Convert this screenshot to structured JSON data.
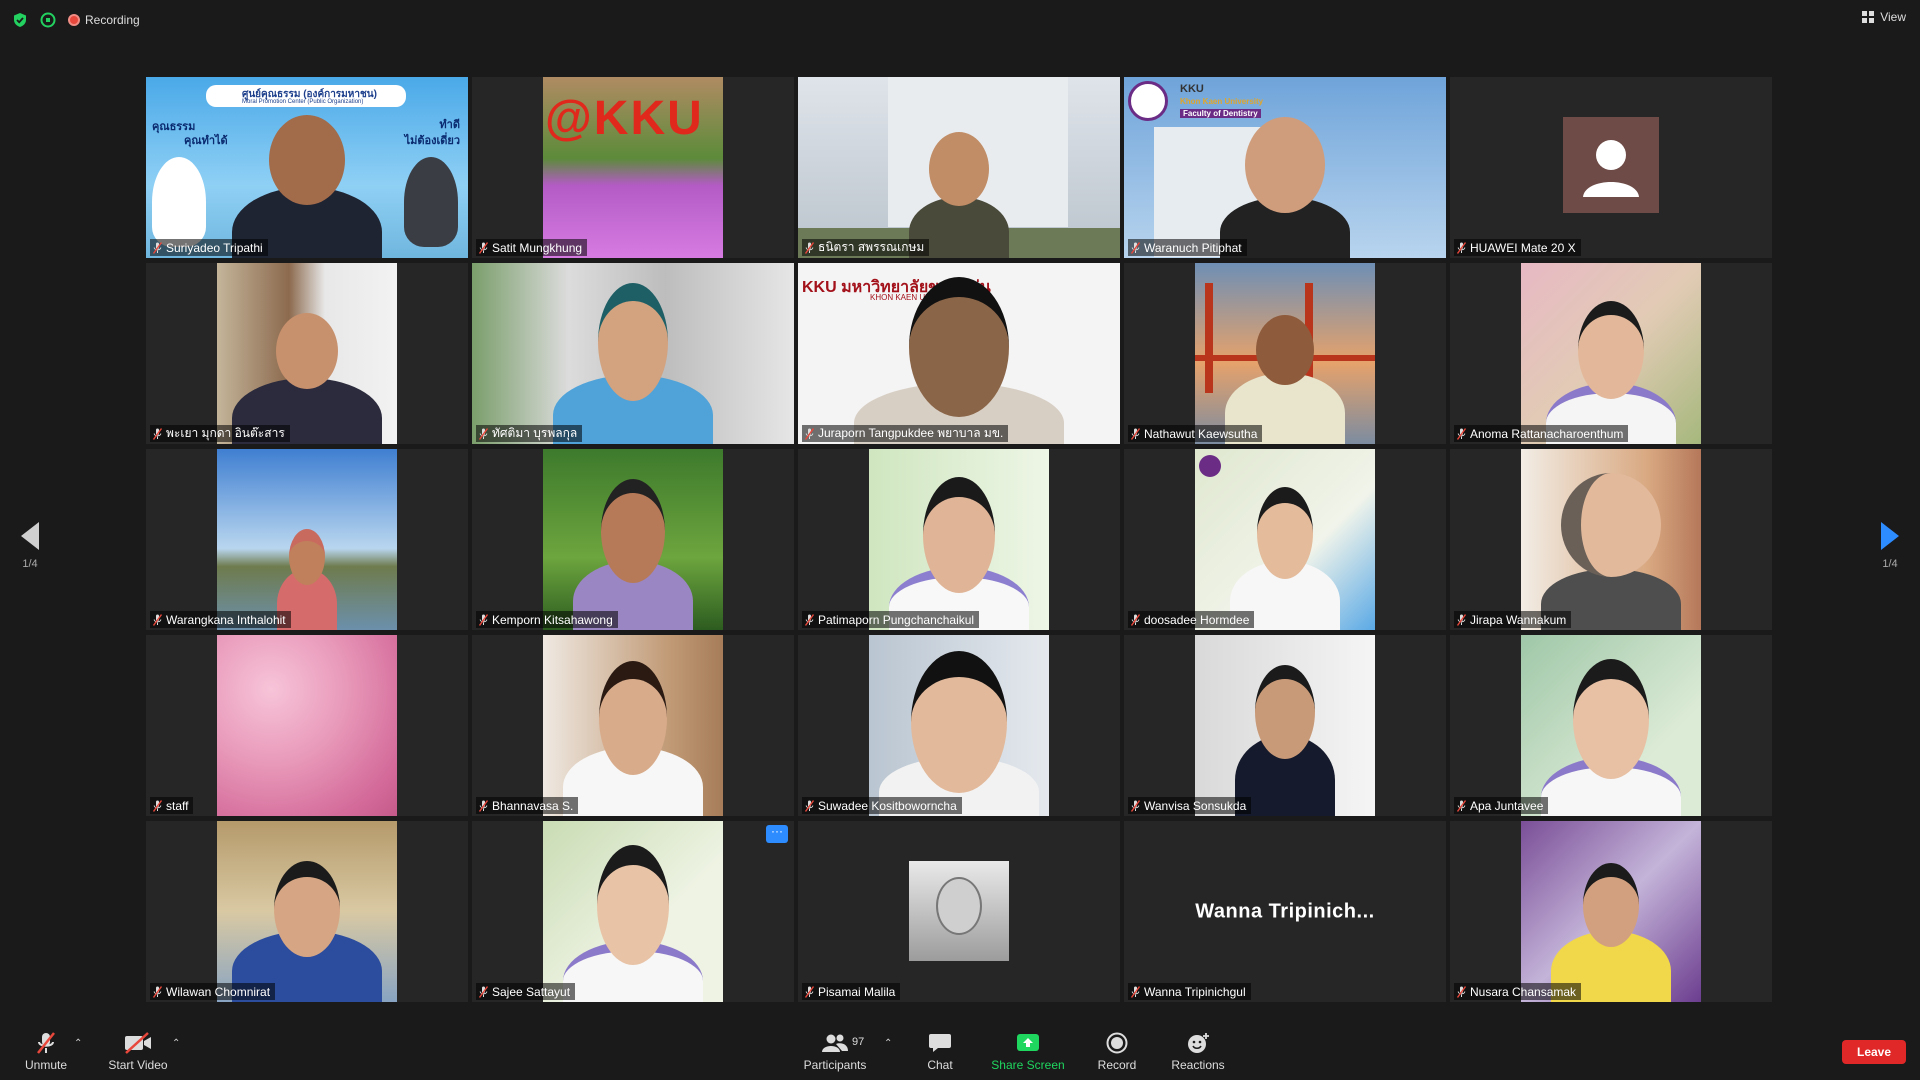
{
  "top_bar": {
    "recording_label": "Recording",
    "view_label": "View",
    "icons": [
      "shield-icon",
      "encryption-icon",
      "recording-icon",
      "grid-view-icon"
    ]
  },
  "pagination": {
    "left": "1/4",
    "right": "1/4"
  },
  "participants": [
    {
      "name": "Suriyadeo Tripathi",
      "active_speaker": true
    },
    {
      "name": "Satit Mungkhung"
    },
    {
      "name": "ธนิตรา สพรรณเกษม"
    },
    {
      "name": "Waranuch Pitiphat"
    },
    {
      "name": "HUAWEI Mate 20 X"
    },
    {
      "name": "พะเยา มุกดา อินต๊ะสาร"
    },
    {
      "name": "ทัศติมา บุรพลกุล"
    },
    {
      "name": "Juraporn Tangpukdee พยาบาล มข."
    },
    {
      "name": "Nathawut Kaewsutha"
    },
    {
      "name": "Anoma Rattanacharoenthum"
    },
    {
      "name": "Warangkana Inthalohit"
    },
    {
      "name": "Kemporn Kitsahawong"
    },
    {
      "name": "Patimaporn Pungchanchaikul"
    },
    {
      "name": "doosadee Hormdee"
    },
    {
      "name": "Jirapa Wannakum"
    },
    {
      "name": "staff"
    },
    {
      "name": "Bhannavasa S."
    },
    {
      "name": "Suwadee Kositboworncha"
    },
    {
      "name": "Wanvisa Sonsukda"
    },
    {
      "name": "Apa Juntavee"
    },
    {
      "name": "Wilawan Chomnirat"
    },
    {
      "name": "Sajee Sattayut"
    },
    {
      "name": "Pisamai Malila"
    },
    {
      "name": "Wanna Tripinichgul",
      "video_off_label": "Wanna  Tripinich..."
    },
    {
      "name": "Nusara Chansamak"
    }
  ],
  "overlays": {
    "kku_logo": "@KKU",
    "kku_banner": "KKU มหาวิทยาลัยขอนแก่น",
    "kku_banner_sub": "KHON KAEN UNIVERSITY",
    "dent_title": "KKU",
    "dent_sub1": "Khon Kaen University",
    "dent_sub2": "Faculty of Dentistry",
    "moral_title": "ศูนย์คุณธรรม (องค์การมหาชน)",
    "moral_sub": "Moral Promotion Center (Public Organization)",
    "moral_left": "คุณธรรม",
    "moral_left2": "คุณทำได้",
    "moral_right": "ทำดี",
    "moral_right2": "ไม่ต้องเดี่ยว"
  },
  "toolbar": {
    "unmute": "Unmute",
    "start_video": "Start Video",
    "participants": "Participants",
    "participants_count": "97",
    "chat": "Chat",
    "share_screen": "Share Screen",
    "record": "Record",
    "reactions": "Reactions",
    "leave": "Leave"
  },
  "colors": {
    "background": "#1a1a1a",
    "tile": "#262626",
    "active_speaker": "#e6e86a",
    "accent": "#2d8cff",
    "share": "#1fd65f",
    "leave": "#e02828",
    "muted": "#e8473b"
  }
}
